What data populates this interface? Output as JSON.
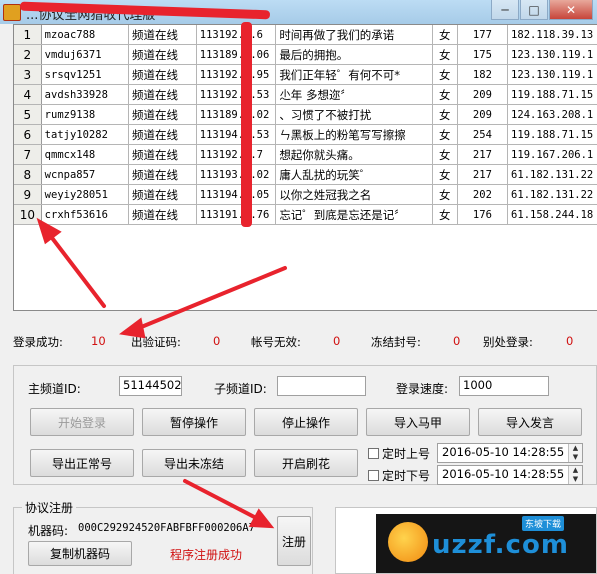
{
  "window": {
    "title": "...协议全网猎收代理版",
    "min_glyph": "─",
    "max_glyph": "□",
    "close_glyph": "✕"
  },
  "grid": {
    "rows": [
      {
        "n": "1",
        "acct": "mzoac788",
        "status": "频道在线",
        "id": "113192...6",
        "msg": "时间再做了我们的承诺",
        "sex": "女",
        "num": "177",
        "ip": "182.118.39.13"
      },
      {
        "n": "2",
        "acct": "vmduj6371",
        "status": "频道在线",
        "id": "113189...06",
        "msg": "最后的拥抱。",
        "sex": "女",
        "num": "175",
        "ip": "123.130.119.1"
      },
      {
        "n": "3",
        "acct": "srsqv1251",
        "status": "频道在线",
        "id": "113192...95",
        "msg": "我们正年轻゜有何不可*",
        "sex": "女",
        "num": "182",
        "ip": "123.130.119.1"
      },
      {
        "n": "4",
        "acct": "avdsh33928",
        "status": "频道在线",
        "id": "113192...53",
        "msg": "尐年 多想迩〞",
        "sex": "女",
        "num": "209",
        "ip": "119.188.71.15"
      },
      {
        "n": "5",
        "acct": "rumz9138",
        "status": "频道在线",
        "id": "113189...02",
        "msg": "、习惯了不被打扰",
        "sex": "女",
        "num": "209",
        "ip": "124.163.208.1"
      },
      {
        "n": "6",
        "acct": "tatjy10282",
        "status": "频道在线",
        "id": "113194...53",
        "msg": "ㄣ黑板上的粉笔写写擦擦",
        "sex": "女",
        "num": "254",
        "ip": "119.188.71.15"
      },
      {
        "n": "7",
        "acct": "qmmcx148",
        "status": "频道在线",
        "id": "113192...7",
        "msg": "想起你就头痛。",
        "sex": "女",
        "num": "217",
        "ip": "119.167.206.1"
      },
      {
        "n": "8",
        "acct": "wcnpa857",
        "status": "频道在线",
        "id": "113193...02",
        "msg": "庸人乱扰的玩笑゜",
        "sex": "女",
        "num": "217",
        "ip": "61.182.131.22"
      },
      {
        "n": "9",
        "acct": "weyiy28051",
        "status": "频道在线",
        "id": "113194...05",
        "msg": "以你之姓冠我之名",
        "sex": "女",
        "num": "202",
        "ip": "61.182.131.22"
      },
      {
        "n": "10",
        "acct": "crxhf53616",
        "status": "频道在线",
        "id": "113191...76",
        "msg": "忘记゜到底是忘还是记〞",
        "sex": "女",
        "num": "176",
        "ip": "61.158.244.18"
      }
    ]
  },
  "stats": {
    "login_ok_label": "登录成功:",
    "login_ok_value": "10",
    "captcha_label": "出验证码:",
    "captcha_value": "0",
    "invalid_label": "帐号无效:",
    "invalid_value": "0",
    "frozen_label": "冻结封号:",
    "frozen_value": "0",
    "elsewhere_label": "别处登录:",
    "elsewhere_value": "0"
  },
  "controls": {
    "main_channel_label": "主频道ID:",
    "main_channel_value": "51144502",
    "sub_channel_label": "子频道ID:",
    "sub_channel_value": "",
    "speed_label": "登录速度:",
    "speed_value": "1000",
    "start_login": "开始登录",
    "pause": "暂停操作",
    "stop": "停止操作",
    "import_vest": "导入马甲",
    "import_speech": "导入发言",
    "export_normal": "导出正常号",
    "export_unfrozen": "导出未冻结",
    "flood": "开启刷花",
    "timed_on_label": "定时上号",
    "timed_on_value": "2016-05-10 14:28:55",
    "timed_off_label": "定时下号",
    "timed_off_value": "2016-05-10 14:28:55"
  },
  "registration": {
    "group_title": "协议注册",
    "machine_code_label": "机器码:",
    "machine_code_value": "000C292924520FABFBFF000206A7",
    "copy_button": "复制机器码",
    "status": "程序注册成功",
    "register_button": "注册"
  },
  "watermark": {
    "brand": "uzzf.com",
    "badge": "东坡下载"
  }
}
